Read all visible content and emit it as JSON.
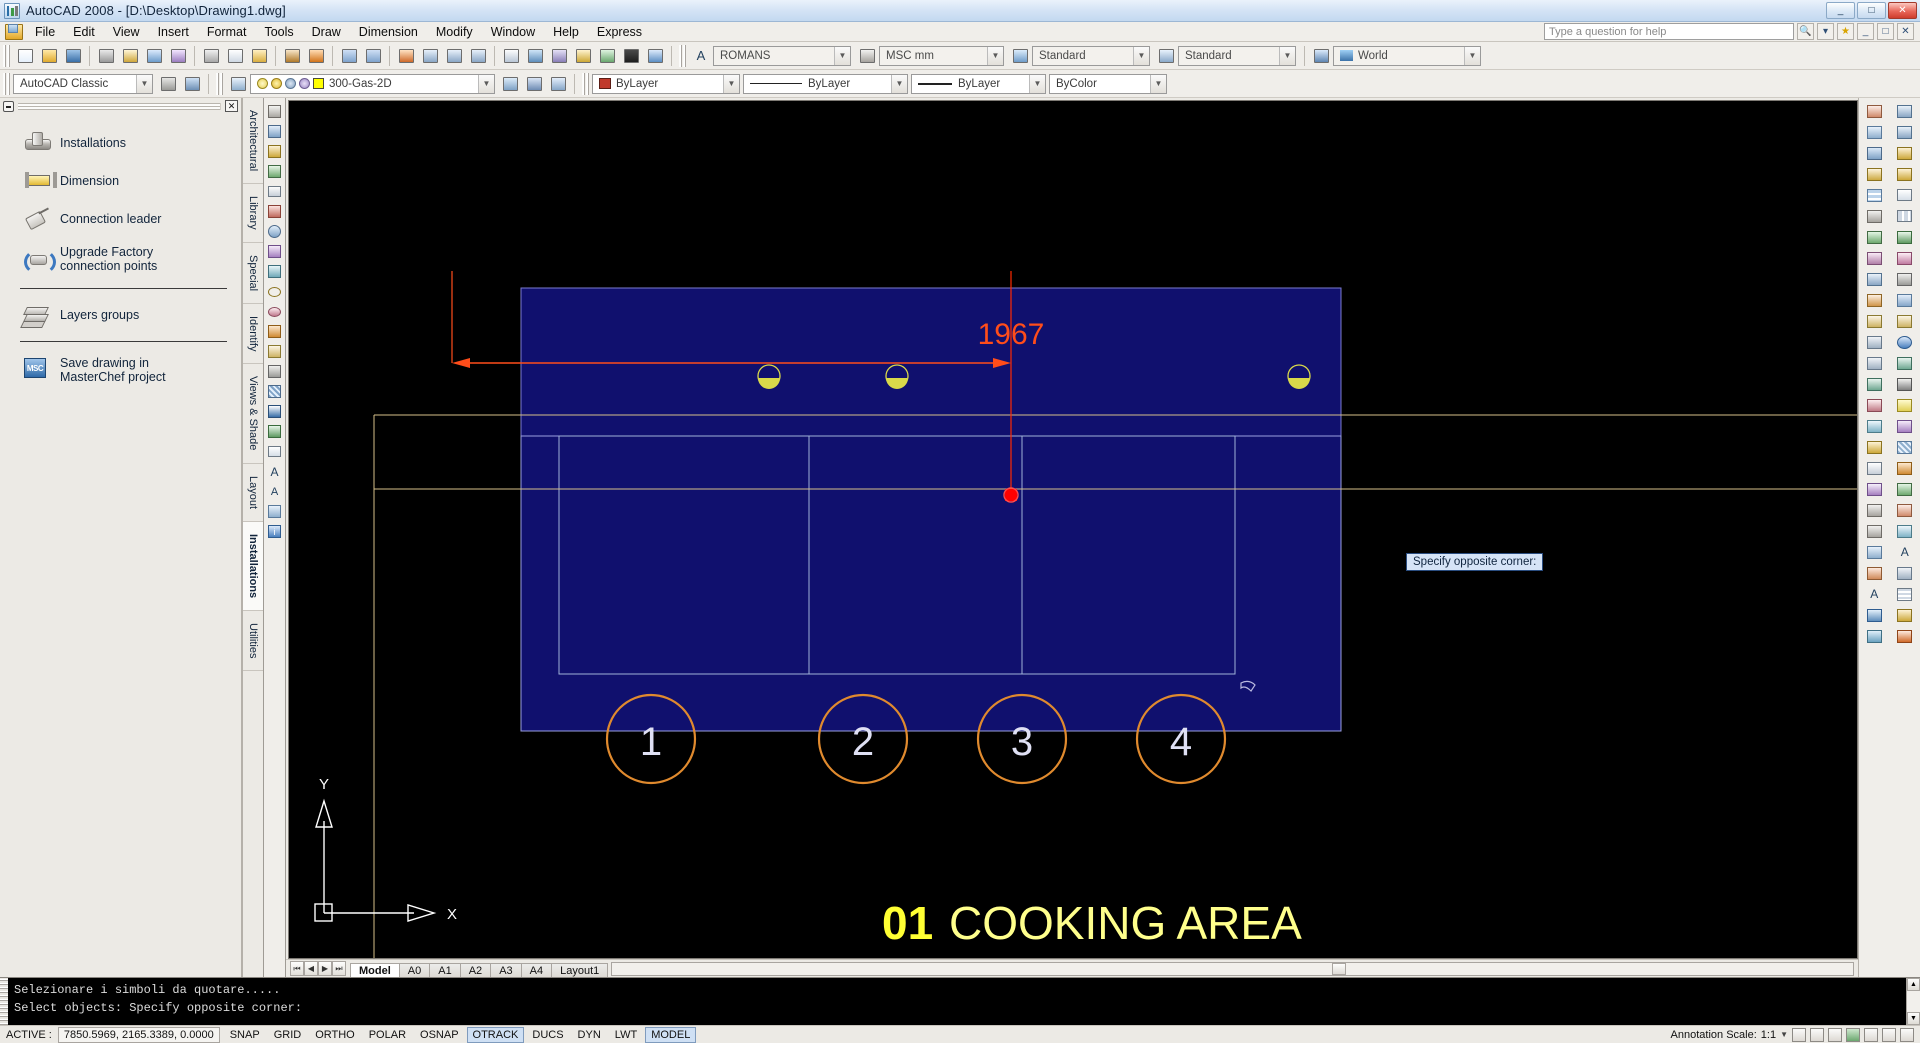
{
  "window": {
    "title": "AutoCAD 2008 - [D:\\Desktop\\Drawing1.dwg]",
    "app_icon": "autocad-icon",
    "minimize": "_",
    "maximize": "□",
    "close": "✕"
  },
  "menubar": {
    "app_icon": "drawing-icon",
    "items": [
      "File",
      "Edit",
      "View",
      "Insert",
      "Format",
      "Tools",
      "Draw",
      "Dimension",
      "Modify",
      "Window",
      "Help",
      "Express"
    ],
    "help_placeholder": "Type a question for help",
    "help_value": "Type a question for help"
  },
  "toolbar1": {
    "text_style": "ROMANS",
    "dim_style": "MSC mm",
    "table_style": "Standard",
    "mleader_style": "Standard",
    "ucs": "World"
  },
  "toolbar2": {
    "workspace": "AutoCAD Classic",
    "layer": "300-Gas-2D",
    "color": "ByLayer",
    "linetype": "ByLayer",
    "lineweight": "ByLayer",
    "plotstyle": "ByColor"
  },
  "left_panel": {
    "close_label": "✕",
    "items": [
      {
        "label": "Installations",
        "icon": "pipe-tee-icon"
      },
      {
        "label": "Dimension",
        "icon": "dimension-icon"
      },
      {
        "label": "Connection leader",
        "icon": "leader-tag-icon"
      },
      {
        "label": "Upgrade Factory connection points",
        "icon": "refresh-pipe-icon"
      }
    ],
    "group2": [
      {
        "label": "Layers groups",
        "icon": "layers-stack-icon"
      }
    ],
    "group3": [
      {
        "label": "Save drawing in MasterChef project",
        "icon": "msc-save-icon"
      }
    ]
  },
  "vertical_tabs": [
    "Architectural",
    "Library",
    "Special",
    "Identify",
    "Views & Shade",
    "Layout",
    "Installations",
    "Utilities"
  ],
  "vertical_tab_selected": "Installations",
  "canvas": {
    "dimension_value": "1967",
    "area_number": "01",
    "area_label": "COOKING AREA",
    "bubbles": [
      "1",
      "2",
      "3",
      "4"
    ],
    "ucs_x": "X",
    "ucs_y": "Y",
    "tooltip": "Specify opposite corner:",
    "colors": {
      "background": "#000000",
      "dimension_red": "#ff4d1a",
      "equipment_blue": "#0f0f6b",
      "bubble_orange": "#e08a2e",
      "text_yellow": "#ffff4d",
      "outline_tan": "#d6c08a",
      "grip_red": "#ff0000"
    }
  },
  "layout_tabs": {
    "nav": [
      "⏮",
      "◀",
      "▶",
      "⏭"
    ],
    "tabs": [
      "Model",
      "A0",
      "A1",
      "A2",
      "A3",
      "A4",
      "Layout1"
    ],
    "selected": "Model"
  },
  "command_window": {
    "lines": [
      "Selezionare i simboli da quotare.....",
      "Select objects: Specify opposite corner:"
    ]
  },
  "statusbar": {
    "state": "ACTIVE :",
    "coordinates": "7850.5969, 2165.3389, 0.0000",
    "toggles": [
      {
        "label": "SNAP",
        "on": false
      },
      {
        "label": "GRID",
        "on": false
      },
      {
        "label": "ORTHO",
        "on": false
      },
      {
        "label": "POLAR",
        "on": false
      },
      {
        "label": "OSNAP",
        "on": false
      },
      {
        "label": "OTRACK",
        "on": true
      },
      {
        "label": "DUCS",
        "on": false
      },
      {
        "label": "DYN",
        "on": false
      },
      {
        "label": "LWT",
        "on": false
      },
      {
        "label": "MODEL",
        "on": true
      }
    ],
    "annotation_scale_label": "Annotation Scale:",
    "annotation_scale_value": "1:1"
  }
}
